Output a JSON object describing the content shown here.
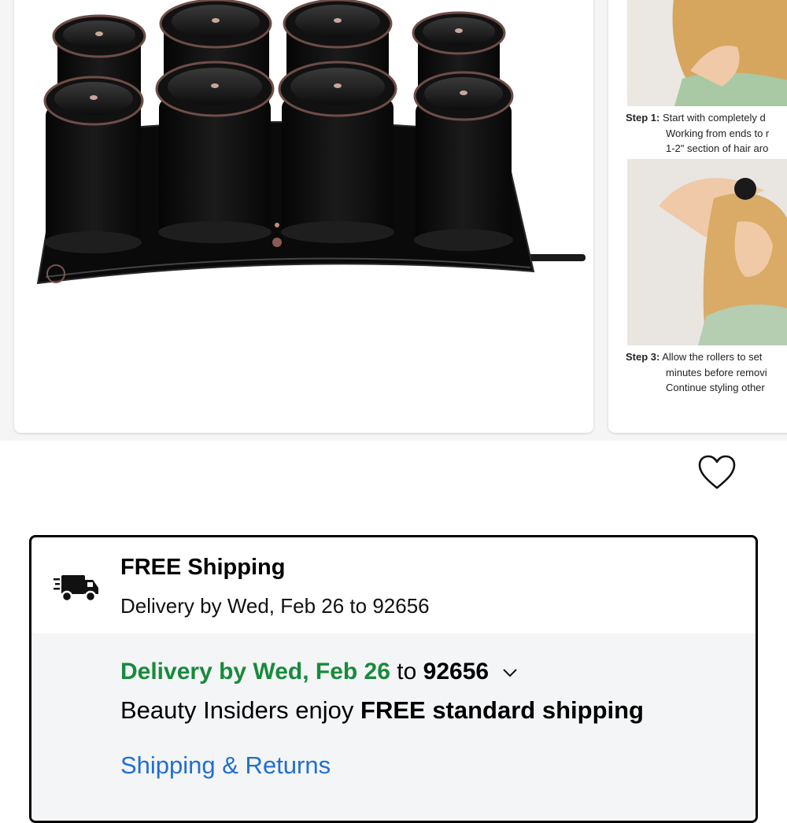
{
  "product_gallery": {
    "steps": [
      {
        "label": "Step 1:",
        "lines": [
          "Start with completely d",
          "Working from ends to r",
          "1-2\" section of hair aro"
        ]
      },
      {
        "label": "Step 3:",
        "lines": [
          "Allow the rollers to set",
          "minutes before removi",
          "Continue styling other"
        ]
      }
    ]
  },
  "wishlist": {
    "icon": "heart-outline-icon"
  },
  "shipping": {
    "icon": "delivery-truck-icon",
    "title": "FREE Shipping",
    "subtitle": "Delivery by Wed, Feb 26 to 92656",
    "delivery_prefix": "Delivery by Wed, Feb 26",
    "delivery_to": "to",
    "zip": "92656",
    "insider_prefix": "Beauty Insiders enjoy",
    "insider_bold": "FREE standard shipping",
    "returns_link": "Shipping & Returns"
  },
  "colors": {
    "green": "#188a3c",
    "link": "#1f6fd1"
  }
}
